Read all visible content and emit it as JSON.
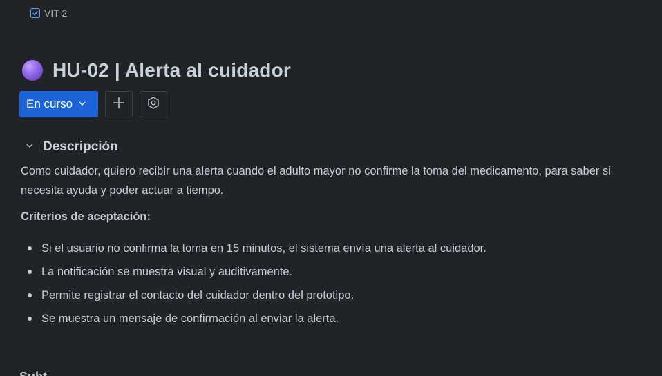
{
  "parent": {
    "key": "VIT-2"
  },
  "issue": {
    "title": "HU-02 | Alerta al cuidador",
    "status": "En curso"
  },
  "description": {
    "heading": "Descripción",
    "body": "Como cuidador, quiero recibir una alerta cuando el adulto mayor no confirme la toma del medicamento, para saber si necesita ayuda y poder actuar a tiempo.",
    "criteria_heading": "Criterios de aceptación:",
    "criteria": [
      "Si el usuario no confirma la toma en 15 minutos, el sistema envía una alerta al cuidador.",
      "La notificación se muestra visual y auditivamente.",
      "Permite registrar el contacto del cuidador dentro del prototipo.",
      "Se muestra un mensaje de confirmación al enviar la alerta."
    ]
  },
  "next_section": {
    "heading": "Subt"
  },
  "icons": {
    "parent": "checkbox-icon",
    "story": "story-icon",
    "status_caret": "chevron-down-icon",
    "add": "plus-icon",
    "watch": "eye-icon",
    "collapse": "chevron-down-icon"
  },
  "colors": {
    "background": "#222327",
    "status_button": "#1d63d8",
    "story_icon": "#8f63e6",
    "link": "#579dff"
  }
}
